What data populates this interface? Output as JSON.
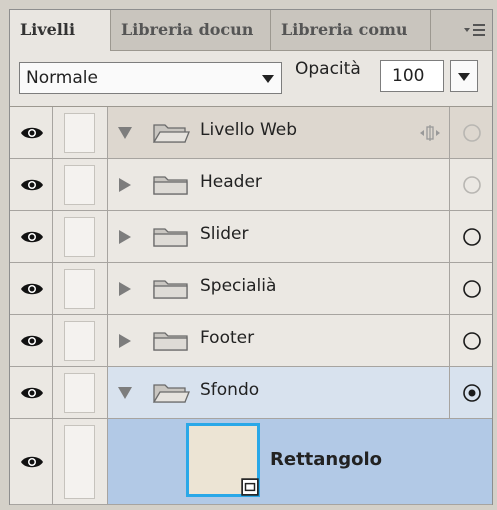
{
  "tabs": [
    {
      "label": "Livelli",
      "active": true
    },
    {
      "label": "Libreria docun",
      "active": false
    },
    {
      "label": "Libreria comu",
      "active": false
    }
  ],
  "options": {
    "blend_mode": "Normale",
    "opacity_label": "Opacità",
    "opacity_value": "100"
  },
  "layers": [
    {
      "name": "Livello Web",
      "kind": "group",
      "expanded": true,
      "indent": 0,
      "background": "#ddd7cf",
      "target": "ring-faint",
      "link_icon": true
    },
    {
      "name": "Header",
      "kind": "group",
      "expanded": false,
      "indent": 1,
      "background": "#ebe8e3",
      "target": "ring-faint"
    },
    {
      "name": "Slider",
      "kind": "group",
      "expanded": false,
      "indent": 1,
      "background": "#ebe8e3",
      "target": "ring"
    },
    {
      "name": "Specialià",
      "kind": "group",
      "expanded": false,
      "indent": 1,
      "background": "#ebe8e3",
      "target": "ring"
    },
    {
      "name": "Footer",
      "kind": "group",
      "expanded": false,
      "indent": 1,
      "background": "#ebe8e3",
      "target": "ring"
    },
    {
      "name": "Sfondo",
      "kind": "group",
      "expanded": true,
      "indent": 1,
      "background": "#d8e2ee",
      "target": "ring-dot"
    },
    {
      "name": "Rettangolo",
      "kind": "shape",
      "indent": 2,
      "background": "#b2c9e6",
      "selected": true,
      "thumb_color": "#ece4d4",
      "thumb_border": "#2aa8e8"
    }
  ],
  "colors": {
    "panel": "#d6d3ce",
    "selected_row": "#b2c9e6",
    "group_selected": "#d8e2ee"
  }
}
